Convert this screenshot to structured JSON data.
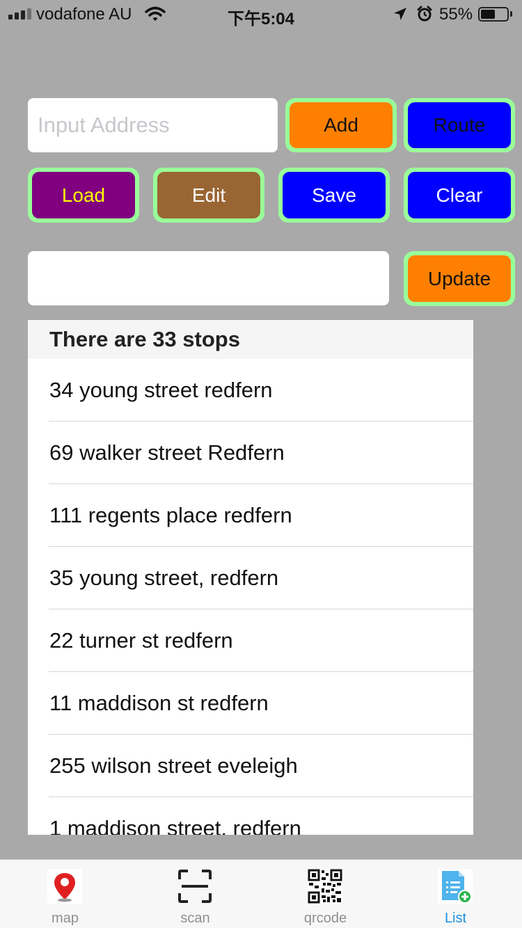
{
  "status_bar": {
    "carrier": "vodafone AU",
    "time": "下午5:04",
    "battery_percent": "55%",
    "battery_level": 0.55,
    "icons": [
      "signal-icon",
      "wifi-icon",
      "location-arrow-icon",
      "alarm-icon",
      "battery-icon"
    ]
  },
  "address_input": {
    "placeholder": "Input Address",
    "value": ""
  },
  "buttons": {
    "add": {
      "label": "Add",
      "color": "#ff8000",
      "text_color": "#111111"
    },
    "route": {
      "label": "Route",
      "color": "#0000ff",
      "text_color": "#111111"
    },
    "load": {
      "label": "Load",
      "color": "#800080",
      "text_color": "#ffff00"
    },
    "edit": {
      "label": "Edit",
      "color": "#996633",
      "text_color": "#ffffff"
    },
    "save": {
      "label": "Save",
      "color": "#0000ff",
      "text_color": "#ffffff"
    },
    "clear": {
      "label": "Clear",
      "color": "#0000ff",
      "text_color": "#ffffff"
    },
    "update": {
      "label": "Update",
      "color": "#ff8000",
      "text_color": "#111111"
    },
    "border_color": "#99ff99"
  },
  "update_input": {
    "value": ""
  },
  "stops": {
    "header": "There are 33 stops",
    "items": [
      "34 young street redfern",
      "69 walker street Redfern",
      "111 regents place redfern",
      "35 young street, redfern",
      "22 turner st redfern",
      "11 maddison st redfern",
      "255 wilson street eveleigh",
      "1 maddison street, redfern"
    ]
  },
  "tab_bar": {
    "tabs": [
      {
        "label": "map",
        "icon": "map-pin-icon",
        "active": false
      },
      {
        "label": "scan",
        "icon": "scan-frame-icon",
        "active": false
      },
      {
        "label": "qrcode",
        "icon": "qrcode-icon",
        "active": false
      },
      {
        "label": "List",
        "icon": "list-add-icon",
        "active": true
      }
    ],
    "active_color": "#1e8fe0"
  }
}
